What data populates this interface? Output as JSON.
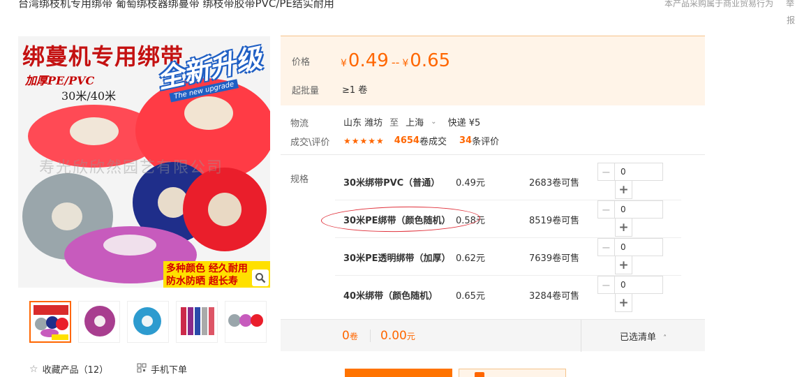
{
  "page": {
    "title": "台湾绑枝机专用绑带 葡萄绑枝器绑蔓带 绑枝带胶带PVC/PE结实耐用",
    "notice": "本产品采购属于商业贸易行为",
    "side_text_top": "举",
    "side_text_bottom": "报"
  },
  "image": {
    "banner": "绑蔓机专用绑带",
    "thick": "加厚PE/PVC",
    "length": "30米/40米",
    "upgrade": "全新升级",
    "upgrade_en": "The new upgrade",
    "watermark": "寿光欣欣然园艺有限公司",
    "promo_line1": "多种颜色 经久耐用",
    "promo_line2": "防水防晒 超长寿",
    "zoom_icon": "magnifier-icon"
  },
  "thumbnails": [
    {
      "name": "thumb-1"
    },
    {
      "name": "thumb-2"
    },
    {
      "name": "thumb-3"
    },
    {
      "name": "thumb-4"
    },
    {
      "name": "thumb-5"
    }
  ],
  "actions": {
    "favorite": "收藏产品（12）",
    "mobile": "手机下单"
  },
  "price": {
    "label": "价格",
    "currency": "¥",
    "min": "0.49",
    "separator": "--",
    "max": "0.65",
    "moq_label": "起批量",
    "moq_value": "≥1 卷"
  },
  "logistics": {
    "label": "物流",
    "from": "山东 潍坊",
    "to_word": "至",
    "to": "上海",
    "shipping": "快递 ¥5",
    "deal_label": "成交\\评价",
    "stars": "★★★★★",
    "rating": 4.5,
    "deals_count": "4654",
    "deals_unit": "卷成交",
    "reviews_count": "34",
    "reviews_unit": "条评价"
  },
  "spec": {
    "label": "规格",
    "rows": [
      {
        "name": "30米绑带PVC（普通）",
        "price": "0.49元",
        "stock": "2683卷可售",
        "qty": "0"
      },
      {
        "name": "30米PE绑带（颜色随机）",
        "price": "0.58元",
        "stock": "8519卷可售",
        "qty": "0"
      },
      {
        "name": "30米PE透明绑带（加厚）",
        "price": "0.62元",
        "stock": "7639卷可售",
        "qty": "0"
      },
      {
        "name": "40米绑带（颜色随机）",
        "price": "0.65元",
        "stock": "3284卷可售",
        "qty": "0"
      }
    ],
    "minus": "−",
    "plus": "+"
  },
  "summary": {
    "count": "0",
    "count_unit": "卷",
    "amount": "0.00",
    "amount_unit": "元",
    "selected": "已选清单",
    "selected_arrow": "˄"
  },
  "colors": {
    "accent": "#ff6600",
    "panel_bg": "#fff4e8",
    "mark": "#e0303a"
  }
}
